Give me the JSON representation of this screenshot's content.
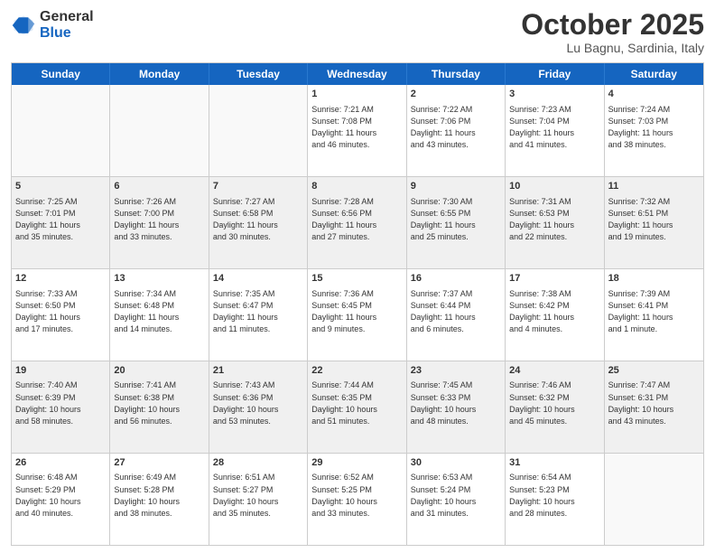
{
  "header": {
    "logo": {
      "line1": "General",
      "line2": "Blue"
    },
    "title": "October 2025",
    "subtitle": "Lu Bagnu, Sardinia, Italy"
  },
  "weekdays": [
    "Sunday",
    "Monday",
    "Tuesday",
    "Wednesday",
    "Thursday",
    "Friday",
    "Saturday"
  ],
  "rows": [
    [
      {
        "day": "",
        "lines": []
      },
      {
        "day": "",
        "lines": []
      },
      {
        "day": "",
        "lines": []
      },
      {
        "day": "1",
        "lines": [
          "Sunrise: 7:21 AM",
          "Sunset: 7:08 PM",
          "Daylight: 11 hours",
          "and 46 minutes."
        ]
      },
      {
        "day": "2",
        "lines": [
          "Sunrise: 7:22 AM",
          "Sunset: 7:06 PM",
          "Daylight: 11 hours",
          "and 43 minutes."
        ]
      },
      {
        "day": "3",
        "lines": [
          "Sunrise: 7:23 AM",
          "Sunset: 7:04 PM",
          "Daylight: 11 hours",
          "and 41 minutes."
        ]
      },
      {
        "day": "4",
        "lines": [
          "Sunrise: 7:24 AM",
          "Sunset: 7:03 PM",
          "Daylight: 11 hours",
          "and 38 minutes."
        ]
      }
    ],
    [
      {
        "day": "5",
        "lines": [
          "Sunrise: 7:25 AM",
          "Sunset: 7:01 PM",
          "Daylight: 11 hours",
          "and 35 minutes."
        ]
      },
      {
        "day": "6",
        "lines": [
          "Sunrise: 7:26 AM",
          "Sunset: 7:00 PM",
          "Daylight: 11 hours",
          "and 33 minutes."
        ]
      },
      {
        "day": "7",
        "lines": [
          "Sunrise: 7:27 AM",
          "Sunset: 6:58 PM",
          "Daylight: 11 hours",
          "and 30 minutes."
        ]
      },
      {
        "day": "8",
        "lines": [
          "Sunrise: 7:28 AM",
          "Sunset: 6:56 PM",
          "Daylight: 11 hours",
          "and 27 minutes."
        ]
      },
      {
        "day": "9",
        "lines": [
          "Sunrise: 7:30 AM",
          "Sunset: 6:55 PM",
          "Daylight: 11 hours",
          "and 25 minutes."
        ]
      },
      {
        "day": "10",
        "lines": [
          "Sunrise: 7:31 AM",
          "Sunset: 6:53 PM",
          "Daylight: 11 hours",
          "and 22 minutes."
        ]
      },
      {
        "day": "11",
        "lines": [
          "Sunrise: 7:32 AM",
          "Sunset: 6:51 PM",
          "Daylight: 11 hours",
          "and 19 minutes."
        ]
      }
    ],
    [
      {
        "day": "12",
        "lines": [
          "Sunrise: 7:33 AM",
          "Sunset: 6:50 PM",
          "Daylight: 11 hours",
          "and 17 minutes."
        ]
      },
      {
        "day": "13",
        "lines": [
          "Sunrise: 7:34 AM",
          "Sunset: 6:48 PM",
          "Daylight: 11 hours",
          "and 14 minutes."
        ]
      },
      {
        "day": "14",
        "lines": [
          "Sunrise: 7:35 AM",
          "Sunset: 6:47 PM",
          "Daylight: 11 hours",
          "and 11 minutes."
        ]
      },
      {
        "day": "15",
        "lines": [
          "Sunrise: 7:36 AM",
          "Sunset: 6:45 PM",
          "Daylight: 11 hours",
          "and 9 minutes."
        ]
      },
      {
        "day": "16",
        "lines": [
          "Sunrise: 7:37 AM",
          "Sunset: 6:44 PM",
          "Daylight: 11 hours",
          "and 6 minutes."
        ]
      },
      {
        "day": "17",
        "lines": [
          "Sunrise: 7:38 AM",
          "Sunset: 6:42 PM",
          "Daylight: 11 hours",
          "and 4 minutes."
        ]
      },
      {
        "day": "18",
        "lines": [
          "Sunrise: 7:39 AM",
          "Sunset: 6:41 PM",
          "Daylight: 11 hours",
          "and 1 minute."
        ]
      }
    ],
    [
      {
        "day": "19",
        "lines": [
          "Sunrise: 7:40 AM",
          "Sunset: 6:39 PM",
          "Daylight: 10 hours",
          "and 58 minutes."
        ]
      },
      {
        "day": "20",
        "lines": [
          "Sunrise: 7:41 AM",
          "Sunset: 6:38 PM",
          "Daylight: 10 hours",
          "and 56 minutes."
        ]
      },
      {
        "day": "21",
        "lines": [
          "Sunrise: 7:43 AM",
          "Sunset: 6:36 PM",
          "Daylight: 10 hours",
          "and 53 minutes."
        ]
      },
      {
        "day": "22",
        "lines": [
          "Sunrise: 7:44 AM",
          "Sunset: 6:35 PM",
          "Daylight: 10 hours",
          "and 51 minutes."
        ]
      },
      {
        "day": "23",
        "lines": [
          "Sunrise: 7:45 AM",
          "Sunset: 6:33 PM",
          "Daylight: 10 hours",
          "and 48 minutes."
        ]
      },
      {
        "day": "24",
        "lines": [
          "Sunrise: 7:46 AM",
          "Sunset: 6:32 PM",
          "Daylight: 10 hours",
          "and 45 minutes."
        ]
      },
      {
        "day": "25",
        "lines": [
          "Sunrise: 7:47 AM",
          "Sunset: 6:31 PM",
          "Daylight: 10 hours",
          "and 43 minutes."
        ]
      }
    ],
    [
      {
        "day": "26",
        "lines": [
          "Sunrise: 6:48 AM",
          "Sunset: 5:29 PM",
          "Daylight: 10 hours",
          "and 40 minutes."
        ]
      },
      {
        "day": "27",
        "lines": [
          "Sunrise: 6:49 AM",
          "Sunset: 5:28 PM",
          "Daylight: 10 hours",
          "and 38 minutes."
        ]
      },
      {
        "day": "28",
        "lines": [
          "Sunrise: 6:51 AM",
          "Sunset: 5:27 PM",
          "Daylight: 10 hours",
          "and 35 minutes."
        ]
      },
      {
        "day": "29",
        "lines": [
          "Sunrise: 6:52 AM",
          "Sunset: 5:25 PM",
          "Daylight: 10 hours",
          "and 33 minutes."
        ]
      },
      {
        "day": "30",
        "lines": [
          "Sunrise: 6:53 AM",
          "Sunset: 5:24 PM",
          "Daylight: 10 hours",
          "and 31 minutes."
        ]
      },
      {
        "day": "31",
        "lines": [
          "Sunrise: 6:54 AM",
          "Sunset: 5:23 PM",
          "Daylight: 10 hours",
          "and 28 minutes."
        ]
      },
      {
        "day": "",
        "lines": []
      }
    ]
  ]
}
